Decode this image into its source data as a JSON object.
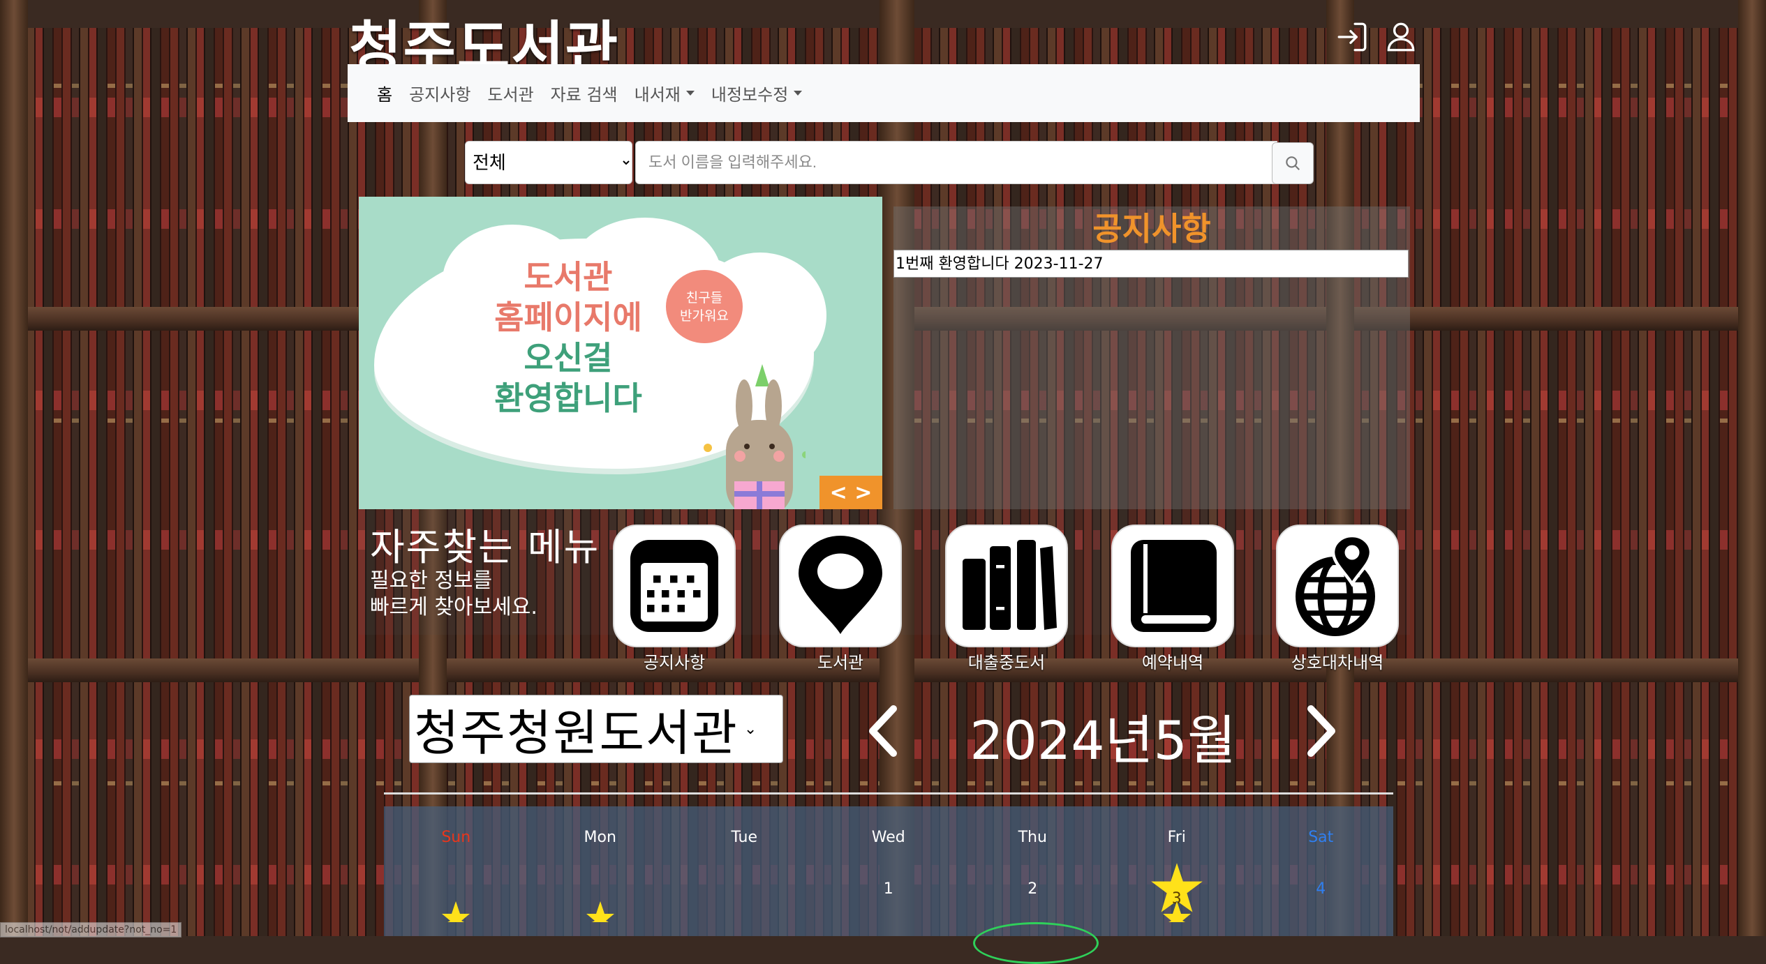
{
  "site": {
    "title": "청주도서관"
  },
  "header_icons": [
    "login-icon",
    "user-icon"
  ],
  "nav": {
    "items": [
      {
        "label": "홈",
        "active": true,
        "dropdown": false
      },
      {
        "label": "공지사항",
        "active": false,
        "dropdown": false
      },
      {
        "label": "도서관",
        "active": false,
        "dropdown": false
      },
      {
        "label": "자료 검색",
        "active": false,
        "dropdown": false
      },
      {
        "label": "내서재",
        "active": false,
        "dropdown": true
      },
      {
        "label": "내정보수정",
        "active": false,
        "dropdown": true
      }
    ]
  },
  "search": {
    "category": "전체",
    "placeholder": "도서 이름을 입력해주세요.",
    "button_icon": "search-icon"
  },
  "banner": {
    "lines": [
      "도서관",
      "홈페이지에",
      "오신걸",
      "환영합니다"
    ],
    "bubble": [
      "친구들",
      "반가워요"
    ],
    "controls": "< >"
  },
  "notice": {
    "title": "공지사항",
    "items": [
      {
        "text": "1번째 환영합니다 2023-11-27"
      }
    ]
  },
  "quick_menu": {
    "title": "자주찾는 메뉴",
    "subtitle_line1": "필요한 정보를",
    "subtitle_line2": "빠르게 찾아보세요.",
    "items": [
      {
        "label": "공지사항",
        "icon": "calendar-icon"
      },
      {
        "label": "도서관",
        "icon": "map-pin-icon"
      },
      {
        "label": "대출중도서",
        "icon": "books-icon"
      },
      {
        "label": "예약내역",
        "icon": "book-icon"
      },
      {
        "label": "상호대차내역",
        "icon": "globe-location-icon"
      }
    ]
  },
  "calendar": {
    "library": "청주청원도서관",
    "month_label": "2024년5월",
    "weekdays": [
      "Sun",
      "Mon",
      "Tue",
      "Wed",
      "Thu",
      "Fri",
      "Sat"
    ],
    "first_week": [
      "",
      "",
      "",
      "1",
      "2",
      "3",
      "4"
    ],
    "highlighted_day": "3",
    "colors": {
      "sunday": "#e8361c",
      "saturday": "#2f7ff0",
      "star": "#ffe11a",
      "accent": "#f0932b"
    }
  },
  "status_bar": {
    "url": "localhost/not/addupdate?not_no=1"
  }
}
